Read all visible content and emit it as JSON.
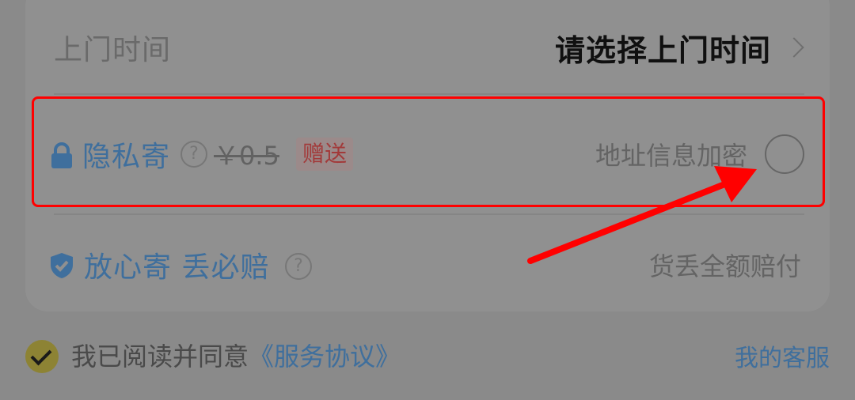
{
  "time_row": {
    "label": "上门时间",
    "value": "请选择上门时间"
  },
  "privacy_row": {
    "title": "隐私寄",
    "help_glyph": "?",
    "original_price": "￥0.5",
    "badge": "赠送",
    "description": "地址信息加密"
  },
  "insure_row": {
    "title": "放心寄 丢必赔",
    "help_glyph": "?",
    "description": "货丢全额赔付"
  },
  "agreement": {
    "prefix": "我已阅读并同意",
    "link": "《服务协议》"
  },
  "service_link": "我的客服",
  "icons": {
    "lock": "lock-icon",
    "shield": "shield-icon",
    "chevron": "chevron-right-icon",
    "help": "question-circle-icon",
    "radio": "radio-unchecked-icon",
    "check": "check-circle-icon"
  },
  "colors": {
    "accent_blue": "#3f6f9d",
    "highlight_red": "#ff0000",
    "badge_red": "#a23a3a"
  }
}
